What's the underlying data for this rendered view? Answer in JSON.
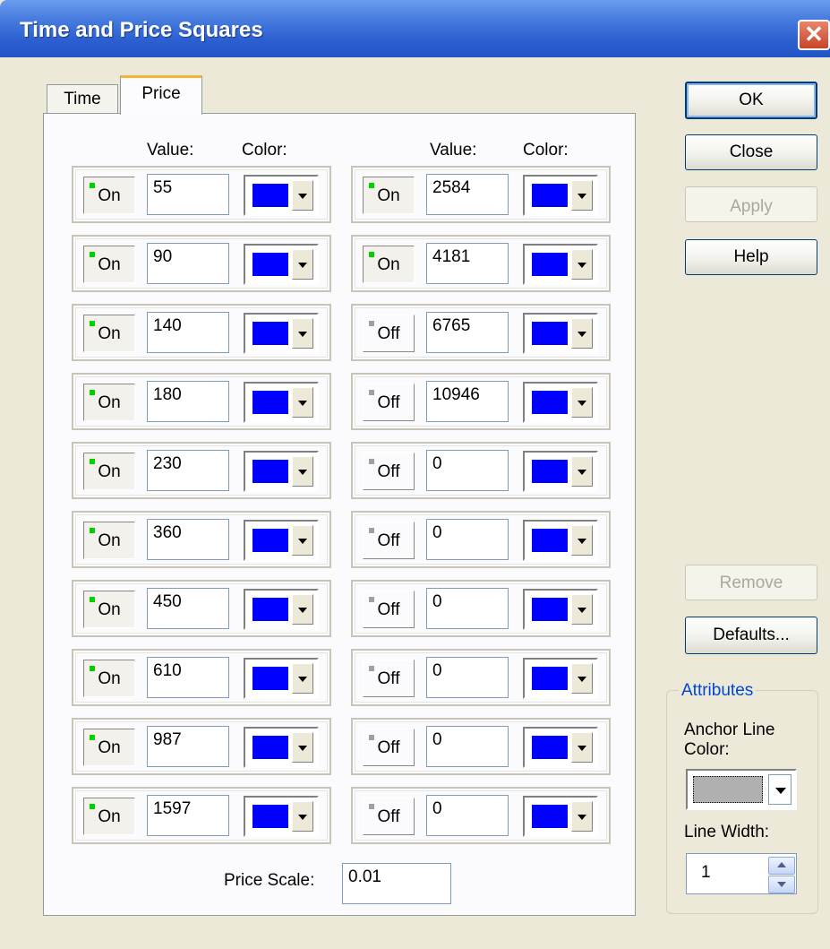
{
  "window": {
    "title": "Time and Price Squares",
    "close_glyph": "✕"
  },
  "tabs": [
    {
      "label": "Time"
    },
    {
      "label": "Price"
    }
  ],
  "headers": {
    "value": "Value:",
    "color": "Color:"
  },
  "left_rows": [
    {
      "toggle": "On",
      "value": "55",
      "color": "#0000ff"
    },
    {
      "toggle": "On",
      "value": "90",
      "color": "#0000ff"
    },
    {
      "toggle": "On",
      "value": "140",
      "color": "#0000ff"
    },
    {
      "toggle": "On",
      "value": "180",
      "color": "#0000ff"
    },
    {
      "toggle": "On",
      "value": "230",
      "color": "#0000ff"
    },
    {
      "toggle": "On",
      "value": "360",
      "color": "#0000ff"
    },
    {
      "toggle": "On",
      "value": "450",
      "color": "#0000ff"
    },
    {
      "toggle": "On",
      "value": "610",
      "color": "#0000ff"
    },
    {
      "toggle": "On",
      "value": "987",
      "color": "#0000ff"
    },
    {
      "toggle": "On",
      "value": "1597",
      "color": "#0000ff"
    }
  ],
  "right_rows": [
    {
      "toggle": "On",
      "value": "2584",
      "color": "#0000ff"
    },
    {
      "toggle": "On",
      "value": "4181",
      "color": "#0000ff"
    },
    {
      "toggle": "Off",
      "value": "6765",
      "color": "#0000ff"
    },
    {
      "toggle": "Off",
      "value": "10946",
      "color": "#0000ff"
    },
    {
      "toggle": "Off",
      "value": "0",
      "color": "#0000ff"
    },
    {
      "toggle": "Off",
      "value": "0",
      "color": "#0000ff"
    },
    {
      "toggle": "Off",
      "value": "0",
      "color": "#0000ff"
    },
    {
      "toggle": "Off",
      "value": "0",
      "color": "#0000ff"
    },
    {
      "toggle": "Off",
      "value": "0",
      "color": "#0000ff"
    },
    {
      "toggle": "Off",
      "value": "0",
      "color": "#0000ff"
    }
  ],
  "price_scale": {
    "label": "Price Scale:",
    "value": "0.01"
  },
  "buttons": {
    "ok": "OK",
    "close": "Close",
    "apply": "Apply",
    "help": "Help",
    "remove": "Remove",
    "defaults": "Defaults..."
  },
  "attributes": {
    "title": "Attributes",
    "anchor_line_color_label": "Anchor Line Color:",
    "anchor_line_color": "#b0b0b0",
    "line_width_label": "Line Width:",
    "line_width_value": "1"
  }
}
